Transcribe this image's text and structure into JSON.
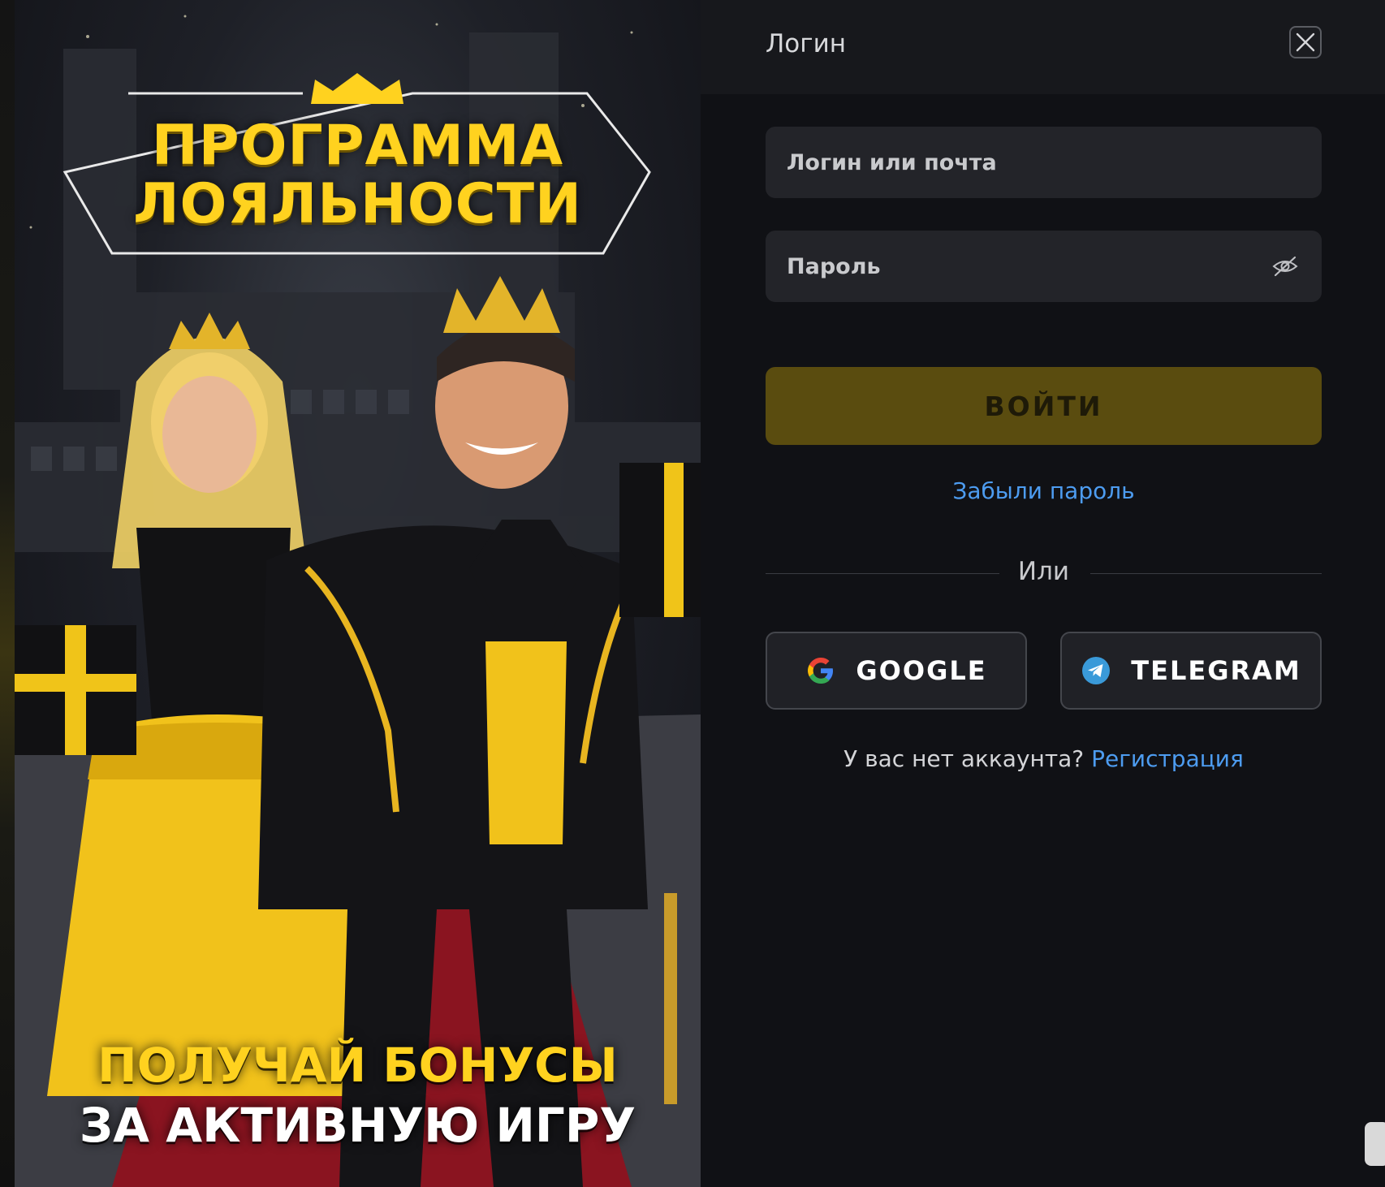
{
  "promo": {
    "title_line1": "ПРОГРАММА",
    "title_line2": "ЛОЯЛЬНОСТИ",
    "bottom_line1": "ПОЛУЧАЙ БОНУСЫ",
    "bottom_line2": "ЗА АКТИВНУЮ ИГРУ"
  },
  "modal": {
    "title": "Логин",
    "close_icon": "close-icon",
    "login_placeholder": "Логин или почта",
    "login_value": "",
    "password_placeholder": "Пароль",
    "password_value": "",
    "password_toggle_icon": "eye-off-icon",
    "submit_label": "ВОЙТИ",
    "forgot_label": "Забыли пароль",
    "or_label": "Или",
    "google_label": "GOOGLE",
    "telegram_label": "TELEGRAM",
    "no_account_text": "У вас нет аккаунта?",
    "register_label": "Регистрация"
  },
  "colors": {
    "accent_gold": "#ffd21f",
    "submit_bg": "#5a4c0f",
    "link_blue": "#4d9cf0",
    "panel_bg": "#101115",
    "field_bg": "#232429"
  }
}
